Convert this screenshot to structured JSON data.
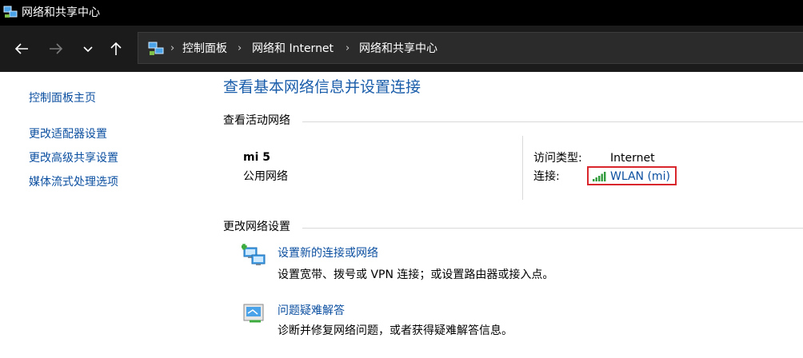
{
  "window": {
    "title": "网络和共享中心"
  },
  "navigation": {
    "breadcrumbs": [
      "控制面板",
      "网络和 Internet",
      "网络和共享中心"
    ],
    "separator": "›"
  },
  "sidebar": {
    "items": [
      {
        "label": "控制面板主页"
      },
      {
        "label": "更改适配器设置"
      },
      {
        "label": "更改高级共享设置"
      },
      {
        "label": "媒体流式处理选项"
      }
    ]
  },
  "main": {
    "heading": "查看基本网络信息并设置连接",
    "active_networks": {
      "section_title": "查看活动网络",
      "network_name": "mi 5",
      "network_category": "公用网络",
      "access_type_label": "访问类型:",
      "access_type_value": "Internet",
      "connection_label": "连接:",
      "connection_value": "WLAN (mi)"
    },
    "change_settings": {
      "section_title": "更改网络设置",
      "tasks": [
        {
          "icon": "network-setup-icon",
          "title": "设置新的连接或网络",
          "description": "设置宽带、拨号或 VPN 连接；或设置路由器或接入点。"
        },
        {
          "icon": "troubleshoot-icon",
          "title": "问题疑难解答",
          "description": "诊断并修复网络问题，或者获得疑难解答信息。"
        }
      ]
    }
  },
  "colors": {
    "link": "#0b4fa0",
    "heading": "#1a5daa",
    "highlight_box": "#d8262c",
    "titlebar": "#000000",
    "navbar": "#1b1b1b"
  }
}
